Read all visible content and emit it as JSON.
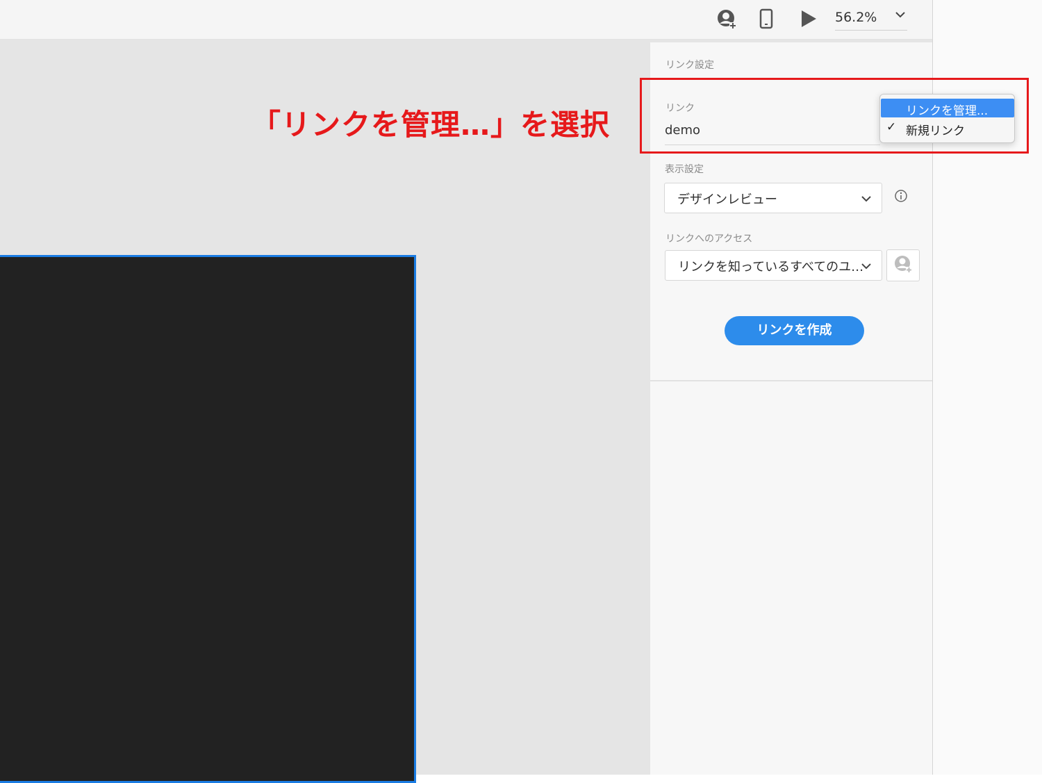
{
  "toolbar": {
    "icons": [
      "share-user-icon",
      "mobile-device-icon",
      "play-icon",
      "chevron-down-icon"
    ],
    "zoom_value": "56.2%"
  },
  "annotation": {
    "text": "「リンクを管理…」を選択",
    "color": "#e6191b"
  },
  "panel": {
    "section_title": "リンク設定",
    "link": {
      "label": "リンク",
      "value": "demo"
    },
    "display": {
      "label": "表示設定",
      "value": "デザインレビュー"
    },
    "access": {
      "label": "リンクへのアクセス",
      "value": "リンクを知っているすべてのユ…"
    },
    "create_button": "リンクを作成"
  },
  "dropdown": {
    "items": [
      {
        "label": "リンクを管理...",
        "highlighted": true,
        "checked": false
      },
      {
        "label": "新規リンク",
        "highlighted": false,
        "checked": true
      }
    ],
    "check_mark": "✓"
  },
  "colors": {
    "accent": "#2d8ceb",
    "highlight": "#3d8ef3",
    "artboard_border": "#1a7ce3",
    "annotation_red": "#e6191b"
  }
}
